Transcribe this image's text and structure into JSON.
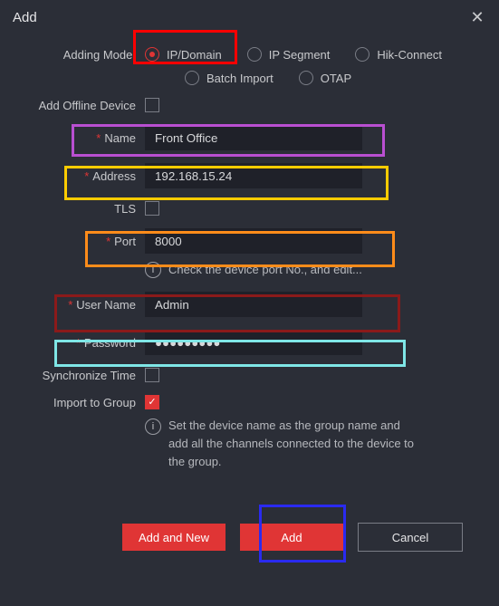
{
  "title": "Add",
  "labels": {
    "adding_mode": "Adding Mode:",
    "add_offline": "Add Offline Device",
    "name": "Name",
    "address": "Address",
    "tls": "TLS",
    "port": "Port",
    "port_hint": "Check the device port No., and edit...",
    "user": "User Name",
    "password": "Password",
    "sync_time": "Synchronize Time",
    "import_group": "Import to Group",
    "group_hint": "Set the device name as the group name and add all the channels connected to the device to the group."
  },
  "modes": {
    "ip_domain": "IP/Domain",
    "ip_segment": "IP Segment",
    "hik_connect": "Hik-Connect",
    "batch_import": "Batch Import",
    "otap": "OTAP"
  },
  "values": {
    "name": "Front Office",
    "address": "192.168.15.24",
    "port": "8000",
    "user": "Admin",
    "password": "●●●●●●●●●"
  },
  "buttons": {
    "add_and_new": "Add and New",
    "add": "Add",
    "cancel": "Cancel"
  }
}
